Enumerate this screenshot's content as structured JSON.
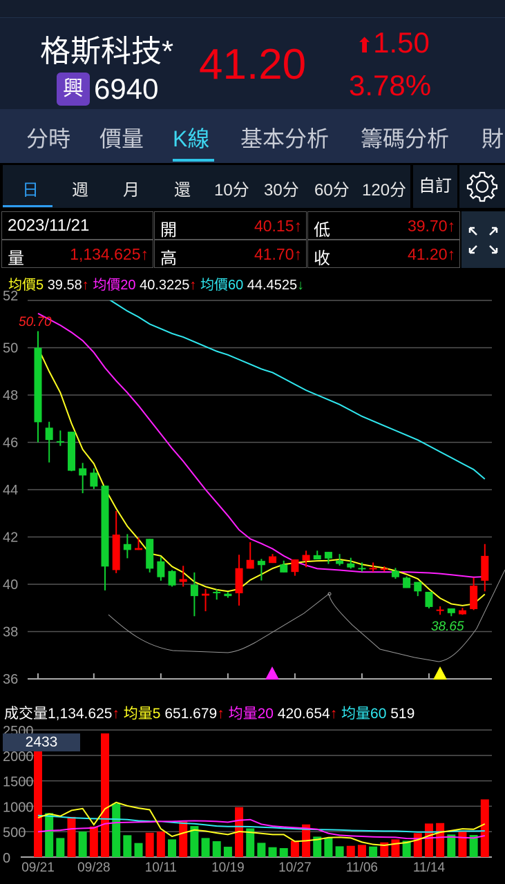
{
  "header": {
    "name": "格斯科技*",
    "badge": "興",
    "code": "6940",
    "price": "41.20",
    "change": "1.50",
    "change_pct": "3.78%",
    "up_color": "#f00010"
  },
  "tabs": [
    "分時",
    "價量",
    "K線",
    "基本分析",
    "籌碼分析",
    "財"
  ],
  "active_tab": "K線",
  "periods": [
    "日",
    "週",
    "月",
    "還",
    "10分",
    "30分",
    "60分",
    "120分"
  ],
  "custom_label": "自訂",
  "info": {
    "date": "2023/11/21",
    "open_label": "開",
    "open": "40.15↑",
    "low_label": "低",
    "low": "39.70↑",
    "vol_label": "量",
    "vol": "1,134.625↑",
    "high_label": "高",
    "high": "41.70↑",
    "close_label": "收",
    "close": "41.20↑"
  },
  "ma_legend": {
    "ma5_label": "均價5",
    "ma5": "39.58",
    "ma5_dir": "↑",
    "ma20_label": "均價20",
    "ma20": "40.3225",
    "ma20_dir": "↑",
    "ma60_label": "均價60",
    "ma60": "44.4525",
    "ma60_dir": "↓"
  },
  "vol_legend": {
    "label": "成交量",
    "value": "1,134.625",
    "dir": "↑",
    "ma5_label": "均量5",
    "ma5": "651.679",
    "ma5_dir": "↑",
    "ma20_label": "均量20",
    "ma20": "420.654",
    "ma20_dir": "↑",
    "ma60_label": "均量60",
    "ma60": "519"
  },
  "chart_data": {
    "type": "candlestick",
    "y_ticks": [
      "52",
      "50",
      "48",
      "46",
      "44",
      "42",
      "40",
      "38",
      "36"
    ],
    "ylim": [
      36,
      52
    ],
    "x_labels": [
      {
        "i": 0,
        "t": "09/21"
      },
      {
        "i": 5,
        "t": "09/28"
      },
      {
        "i": 11,
        "t": "10/11"
      },
      {
        "i": 17,
        "t": "10/19"
      },
      {
        "i": 23,
        "t": "10/27"
      },
      {
        "i": 29,
        "t": "11/06"
      },
      {
        "i": 35,
        "t": "11/14"
      }
    ],
    "high_label": "50.70",
    "low_label": "38.65",
    "ohlc": [
      [
        50.0,
        50.7,
        46.0,
        46.85
      ],
      [
        46.62,
        46.87,
        45.15,
        46.1
      ],
      [
        46.05,
        46.5,
        45.85,
        46.0
      ],
      [
        46.45,
        46.45,
        44.78,
        44.8
      ],
      [
        44.9,
        45.13,
        43.85,
        44.6
      ],
      [
        44.72,
        44.9,
        44.03,
        44.13
      ],
      [
        44.17,
        44.17,
        39.74,
        40.75
      ],
      [
        40.6,
        43.1,
        40.47,
        42.1
      ],
      [
        41.7,
        42.12,
        41.1,
        41.45
      ],
      [
        41.45,
        41.97,
        41.45,
        41.53
      ],
      [
        41.92,
        41.92,
        40.5,
        40.66
      ],
      [
        40.97,
        41.15,
        40.15,
        40.3
      ],
      [
        40.56,
        40.6,
        39.9,
        39.95
      ],
      [
        40.1,
        40.78,
        39.9,
        40.22
      ],
      [
        39.98,
        40.5,
        38.65,
        39.5
      ],
      [
        39.52,
        39.8,
        38.86,
        39.6
      ],
      [
        39.68,
        39.78,
        39.35,
        39.63
      ],
      [
        39.6,
        39.67,
        39.43,
        39.5
      ],
      [
        39.62,
        41.25,
        39.1,
        40.68
      ],
      [
        40.66,
        41.78,
        40.66,
        41.03
      ],
      [
        40.99,
        41.07,
        40.16,
        40.81
      ],
      [
        40.9,
        41.28,
        40.9,
        41.18
      ],
      [
        40.84,
        41.0,
        40.5,
        40.5
      ],
      [
        40.52,
        41.05,
        40.36,
        41.05
      ],
      [
        41.0,
        41.42,
        40.72,
        41.24
      ],
      [
        41.23,
        41.42,
        41.05,
        41.05
      ],
      [
        41.37,
        41.37,
        40.86,
        41.09
      ],
      [
        41.0,
        41.28,
        40.79,
        40.86
      ],
      [
        40.88,
        41.12,
        40.66,
        40.71
      ],
      [
        40.69,
        40.92,
        40.53,
        40.64
      ],
      [
        40.66,
        40.92,
        40.53,
        40.69
      ],
      [
        40.64,
        40.76,
        40.54,
        40.67
      ],
      [
        40.57,
        40.69,
        40.23,
        40.3
      ],
      [
        40.28,
        40.33,
        39.84,
        39.84
      ],
      [
        40.1,
        40.1,
        39.5,
        39.7
      ],
      [
        39.68,
        39.68,
        38.98,
        39.04
      ],
      [
        38.88,
        39.07,
        38.71,
        38.93
      ],
      [
        38.98,
        38.98,
        38.65,
        38.78
      ],
      [
        38.73,
        39.0,
        38.71,
        38.9
      ],
      [
        38.95,
        40.28,
        38.91,
        39.94
      ],
      [
        40.15,
        41.7,
        39.7,
        41.2
      ]
    ],
    "ma5": [
      50.0,
      49.0,
      48.1,
      46.8,
      45.7,
      45.1,
      44.05,
      43.2,
      42.45,
      41.9,
      41.3,
      41.2,
      40.75,
      40.5,
      40.1,
      39.9,
      39.77,
      39.7,
      39.8,
      40.18,
      40.42,
      40.67,
      40.84,
      40.9,
      40.96,
      40.99,
      41.0,
      41.05,
      40.98,
      40.84,
      40.76,
      40.69,
      40.57,
      40.42,
      40.23,
      39.8,
      39.41,
      39.17,
      39.1,
      39.17,
      39.58
    ],
    "ma20": [
      51.45,
      51.2,
      50.95,
      50.65,
      50.3,
      49.8,
      49.15,
      48.6,
      48.1,
      47.55,
      46.95,
      46.35,
      45.75,
      45.2,
      44.6,
      44.0,
      43.45,
      42.9,
      42.3,
      41.92,
      41.72,
      41.5,
      41.2,
      40.96,
      40.8,
      40.66,
      40.63,
      40.6,
      40.56,
      40.52,
      40.52,
      40.52,
      40.52,
      40.52,
      40.5,
      40.48,
      40.45,
      40.4,
      40.35,
      40.3,
      40.32
    ],
    "ma60": [
      54.0,
      53.7,
      53.4,
      53.1,
      52.8,
      52.5,
      52.15,
      51.85,
      51.55,
      51.3,
      51.0,
      50.8,
      50.6,
      50.45,
      50.25,
      50.05,
      49.85,
      49.7,
      49.5,
      49.3,
      49.1,
      48.95,
      48.7,
      48.45,
      48.2,
      48.0,
      47.8,
      47.6,
      47.35,
      47.1,
      46.9,
      46.7,
      46.5,
      46.3,
      46.1,
      45.85,
      45.6,
      45.35,
      45.1,
      44.85,
      44.45
    ],
    "colors": {
      "up": "#ff0000",
      "down": "#10d030",
      "ma5": "#ffff20",
      "ma20": "#ff20ff",
      "ma60": "#30e8f0"
    },
    "volume": {
      "y_ticks": [
        "2500",
        "2000",
        "1500",
        "1000",
        "500",
        "0"
      ],
      "ylim": [
        0,
        2500
      ],
      "max_label": "2433",
      "values": [
        2090,
        864,
        375,
        791,
        502,
        601,
        2433,
        1053,
        430,
        276,
        479,
        502,
        348,
        705,
        610,
        375,
        312,
        203,
        981,
        565,
        280,
        194,
        176,
        321,
        642,
        402,
        384,
        212,
        221,
        240,
        208,
        289,
        348,
        321,
        470,
        660,
        669,
        443,
        506,
        434,
        1135
      ],
      "dir": "rggrgrrgggrrgrggggrggggrrgggrrgrrgrrrgrgr",
      "ma5": [
        773,
        850,
        805,
        918,
        954,
        637,
        950,
        1076,
        1008,
        963,
        931,
        556,
        407,
        474,
        533,
        511,
        474,
        443,
        502,
        488,
        466,
        443,
        443,
        307,
        321,
        344,
        384,
        389,
        375,
        294,
        249,
        231,
        262,
        285,
        339,
        420,
        488,
        520,
        556,
        547,
        652
      ],
      "ma20": [
        497,
        520,
        529,
        556,
        565,
        574,
        656,
        678,
        683,
        687,
        692,
        701,
        701,
        710,
        714,
        710,
        701,
        687,
        723,
        737,
        646,
        610,
        592,
        579,
        565,
        547,
        466,
        430,
        416,
        407,
        398,
        393,
        389,
        366,
        362,
        375,
        389,
        398,
        384,
        375,
        421
      ],
      "ma60": [
        818,
        805,
        791,
        773,
        764,
        755,
        750,
        746,
        737,
        714,
        705,
        701,
        683,
        665,
        656,
        633,
        610,
        601,
        601,
        597,
        588,
        579,
        565,
        556,
        547,
        542,
        538,
        533,
        524,
        520,
        515,
        511,
        511,
        502,
        493,
        493,
        497,
        506,
        511,
        511,
        515
      ]
    }
  }
}
